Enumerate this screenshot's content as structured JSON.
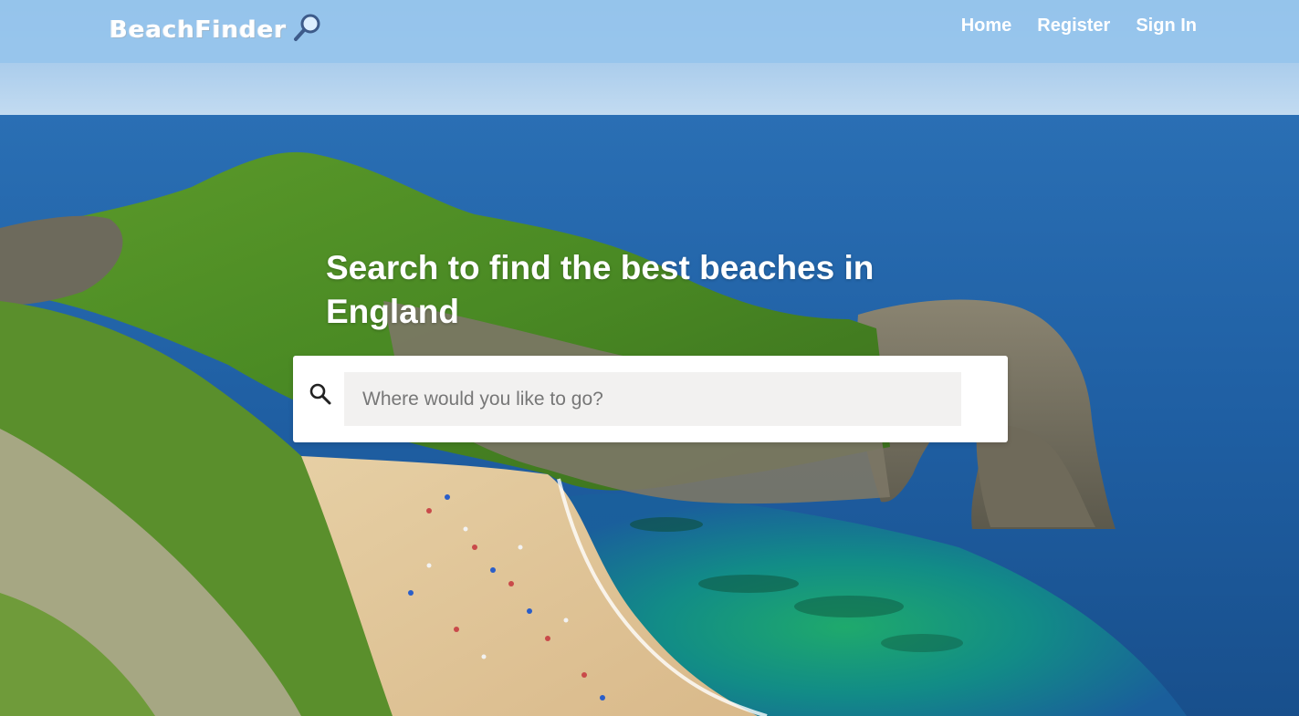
{
  "brand": {
    "name": "BeachFinder",
    "icon": "magnifying-glass-emoji",
    "icon_glyph": "🔎"
  },
  "nav": {
    "links": [
      {
        "label": "Home"
      },
      {
        "label": "Register"
      },
      {
        "label": "Sign In"
      }
    ]
  },
  "hero": {
    "headline": "Search to find the best beaches in England",
    "background": "coastal-cliff-beach-photo"
  },
  "search": {
    "placeholder": "Where would you like to go?",
    "value": "",
    "icon": "search-icon"
  },
  "colors": {
    "navbar": "#96c4eb",
    "nav_text": "#ffffff",
    "input_bg": "#f2f1f0",
    "card_bg": "#ffffff"
  }
}
